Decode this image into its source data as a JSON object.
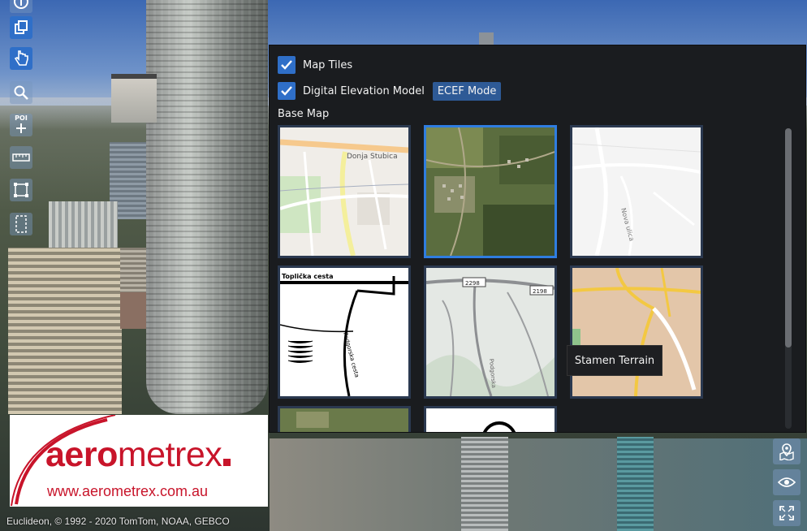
{
  "panel": {
    "map_tiles_label": "Map Tiles",
    "map_tiles_checked": true,
    "dem_label": "Digital Elevation Model",
    "dem_checked": true,
    "ecef_label": "ECEF Mode",
    "base_map_label": "Base Map",
    "tooltip": "Stamen Terrain",
    "tiles": [
      {
        "map_labels": [
          "Donja Stubica"
        ],
        "selected": false
      },
      {
        "map_labels": [],
        "selected": true
      },
      {
        "map_labels": [
          "Nova ulica"
        ],
        "selected": false
      },
      {
        "map_labels": [
          "Toplička cesta",
          "Podgorska cesta"
        ],
        "selected": false
      },
      {
        "map_labels": [
          "2298",
          "2198",
          "Podgorska"
        ],
        "selected": false
      },
      {
        "map_labels": [],
        "selected": false
      }
    ]
  },
  "logo": {
    "word_bold": "aero",
    "word_regular": "metrex",
    "url": "www.aerometrex.com.au"
  },
  "attribution": "Euclideon, © 1992 - 2020 TomTom, NOAA, GEBCO",
  "toolbar_left": {
    "poi_label": "POI"
  },
  "colors": {
    "accent": "#2f6fc8",
    "panel_bg": "#1a1c1f",
    "brand_red": "#c8142a"
  }
}
